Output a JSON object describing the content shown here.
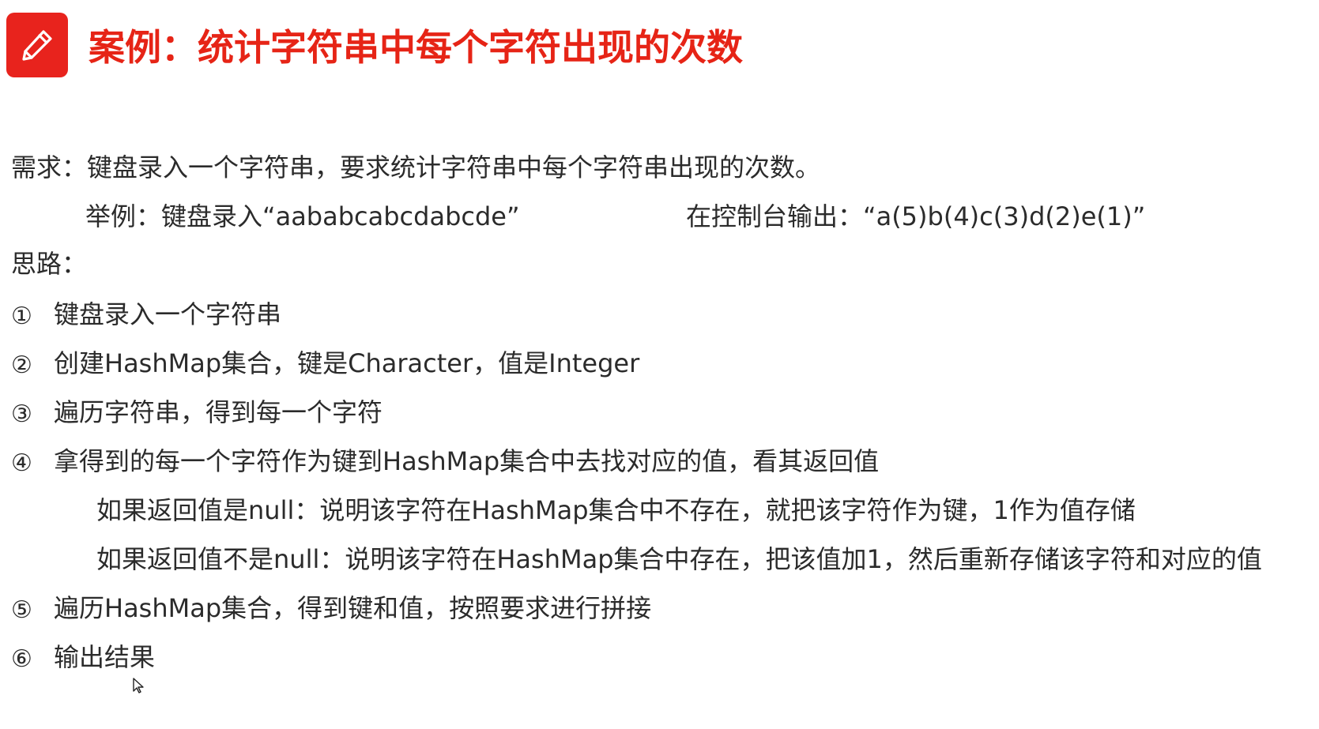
{
  "header": {
    "icon": "pencil-icon",
    "title": "案例：统计字符串中每个字符出现的次数"
  },
  "requirement": {
    "label": "需求：",
    "text": "键盘录入一个字符串，要求统计字符串中每个字符串出现的次数。",
    "example_label": "举例：键盘录入“aababcabcdabcde”",
    "output_label": "在控制台输出：“a(5)b(4)c(3)d(2)e(1)”"
  },
  "approach": {
    "label": "思路：",
    "steps": [
      {
        "num": "①",
        "text": "键盘录入一个字符串"
      },
      {
        "num": "②",
        "text": "创建HashMap集合，键是Character，值是Integer"
      },
      {
        "num": "③",
        "text": "遍历字符串，得到每一个字符"
      },
      {
        "num": "④",
        "text": "拿得到的每一个字符作为键到HashMap集合中去找对应的值，看其返回值"
      },
      {
        "num": "⑤",
        "text": "遍历HashMap集合，得到键和值，按照要求进行拼接"
      },
      {
        "num": "⑥",
        "text": "输出结果"
      }
    ],
    "sub_steps": [
      "如果返回值是null：说明该字符在HashMap集合中不存在，就把该字符作为键，1作为值存储",
      "如果返回值不是null：说明该字符在HashMap集合中存在，把该值加1，然后重新存储该字符和对应的值"
    ]
  }
}
